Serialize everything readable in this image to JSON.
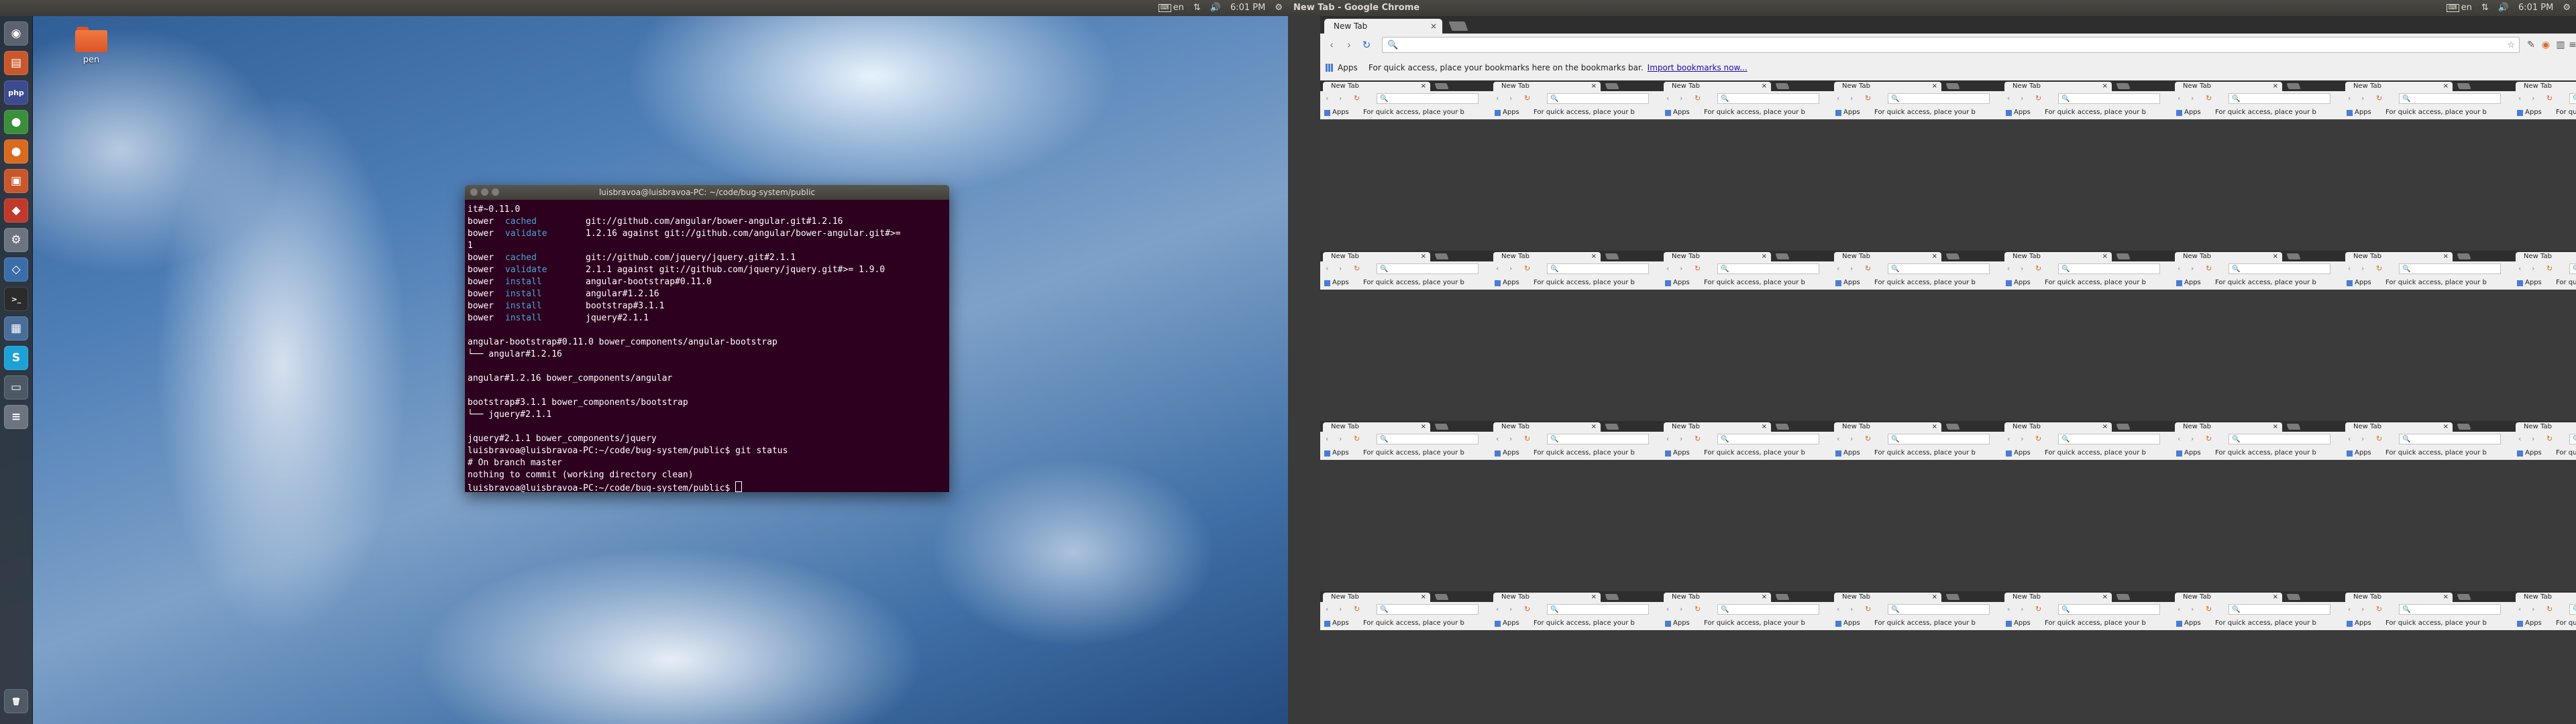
{
  "left_screen": {
    "panel": {
      "keyboard": "en",
      "time": "6:01 PM"
    },
    "desktop_icon": {
      "label": "pen"
    },
    "launcher": {
      "items": [
        {
          "icon": "dash-icon",
          "glyph": "◉",
          "color": "#5b6270"
        },
        {
          "icon": "files-icon",
          "glyph": "▤",
          "color": "#c9572b"
        },
        {
          "icon": "php-app-icon",
          "glyph": "php",
          "color": "#3c4a8f"
        },
        {
          "icon": "chrome-icon",
          "glyph": "●",
          "color": "#3a8f3a"
        },
        {
          "icon": "firefox-icon",
          "glyph": "●",
          "color": "#d96a1f"
        },
        {
          "icon": "software-center-icon",
          "glyph": "▣",
          "color": "#c9572b"
        },
        {
          "icon": "app-red-icon",
          "glyph": "◆",
          "color": "#c0392b"
        },
        {
          "icon": "settings-icon",
          "glyph": "⚙",
          "color": "#6c7480"
        },
        {
          "icon": "app-blue-icon",
          "glyph": "◇",
          "color": "#3b6ea8"
        },
        {
          "icon": "terminal-icon",
          "glyph": ">_",
          "color": "#2b2b2b"
        },
        {
          "icon": "package-icon",
          "glyph": "▦",
          "color": "#4a6e9a"
        },
        {
          "icon": "skype-icon",
          "glyph": "S",
          "color": "#1da1d6"
        },
        {
          "icon": "window-icon",
          "glyph": "▭",
          "color": "#4f5966"
        },
        {
          "icon": "drive-icon",
          "glyph": "≡",
          "color": "#6c7480"
        },
        {
          "icon": "trash-icon",
          "glyph": "🗑",
          "color": "#505a66"
        }
      ]
    },
    "terminal": {
      "title": "luisbravoa@luisbravoa-PC: ~/code/bug-system/public",
      "lines": [
        {
          "pre": "",
          "cmd": "",
          "rest": "it#~0.11.0"
        },
        {
          "pre": "bower",
          "cmd": "cached",
          "rest": "git://github.com/angular/bower-angular.git#1.2.16"
        },
        {
          "pre": "bower",
          "cmd": "validate",
          "rest": "1.2.16 against git://github.com/angular/bower-angular.git#>="
        },
        {
          "pre": "",
          "cmd": "",
          "rest": "1"
        },
        {
          "pre": "bower",
          "cmd": "cached",
          "rest": "git://github.com/jquery/jquery.git#2.1.1"
        },
        {
          "pre": "bower",
          "cmd": "validate",
          "rest": "2.1.1 against git://github.com/jquery/jquery.git#>= 1.9.0"
        },
        {
          "pre": "bower",
          "cmd": "install",
          "rest": "angular-bootstrap#0.11.0"
        },
        {
          "pre": "bower",
          "cmd": "install",
          "rest": "angular#1.2.16"
        },
        {
          "pre": "bower",
          "cmd": "install",
          "rest": "bootstrap#3.1.1"
        },
        {
          "pre": "bower",
          "cmd": "install",
          "rest": "jquery#2.1.1"
        },
        {
          "pre": "",
          "cmd": "",
          "rest": ""
        },
        {
          "pre": "",
          "cmd": "",
          "rest": "angular-bootstrap#0.11.0 bower_components/angular-bootstrap"
        },
        {
          "pre": "",
          "cmd": "",
          "rest": "└── angular#1.2.16"
        },
        {
          "pre": "",
          "cmd": "",
          "rest": ""
        },
        {
          "pre": "",
          "cmd": "",
          "rest": "angular#1.2.16 bower_components/angular"
        },
        {
          "pre": "",
          "cmd": "",
          "rest": ""
        },
        {
          "pre": "",
          "cmd": "",
          "rest": "bootstrap#3.1.1 bower_components/bootstrap"
        },
        {
          "pre": "",
          "cmd": "",
          "rest": "└── jquery#2.1.1"
        },
        {
          "pre": "",
          "cmd": "",
          "rest": ""
        },
        {
          "pre": "",
          "cmd": "",
          "rest": "jquery#2.1.1 bower_components/jquery"
        },
        {
          "pre": "",
          "cmd": "",
          "rest": "luisbravoa@luisbravoa-PC:~/code/bug-system/public$ git status"
        },
        {
          "pre": "",
          "cmd": "",
          "rest": "# On branch master"
        },
        {
          "pre": "",
          "cmd": "",
          "rest": "nothing to commit (working directory clean)"
        },
        {
          "pre": "",
          "cmd": "",
          "rest": "luisbravoa@luisbravoa-PC:~/code/bug-system/public$ "
        }
      ]
    }
  },
  "right_screen": {
    "panel": {
      "title": "New Tab - Google Chrome",
      "keyboard": "en",
      "time": "6:01 PM"
    },
    "chrome": {
      "tab_label": "New Tab",
      "tab_close": "×",
      "bookmarks": {
        "apps_label": "Apps",
        "message": "For quick access, place your bookmarks here on the bookmarks bar.",
        "import_link": "Import bookmarks now..."
      },
      "mini_bookmark_message": "For quick access, place your b"
    }
  }
}
